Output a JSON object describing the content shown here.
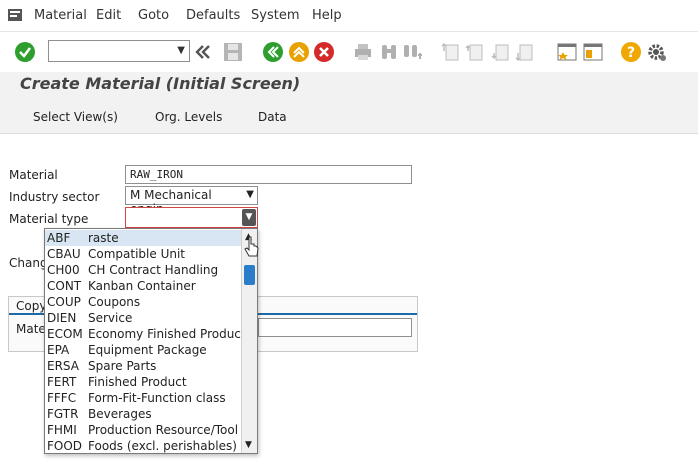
{
  "menu": {
    "items": [
      "Material",
      "Edit",
      "Goto",
      "Defaults",
      "System",
      "Help"
    ]
  },
  "toolbar": {
    "command_field_value": ""
  },
  "title": "Create Material (Initial Screen)",
  "app_toolbar": {
    "buttons": [
      "Select View(s)",
      "Org. Levels",
      "Data"
    ]
  },
  "form": {
    "material_label": "Material",
    "material_value": "RAW_IRON",
    "industry_label": "Industry sector",
    "industry_value": "M Mechanical engin...",
    "type_label": "Material type",
    "type_value": "",
    "change_label_partial": "Chang",
    "copy_tab_partial": "Copy",
    "copy_material_partial": "Mate"
  },
  "dropdown": {
    "options": [
      {
        "code": "ABF",
        "desc": "raste"
      },
      {
        "code": "CBAU",
        "desc": "Compatible Unit"
      },
      {
        "code": "CH00",
        "desc": "CH Contract Handling"
      },
      {
        "code": "CONT",
        "desc": "Kanban Container"
      },
      {
        "code": "COUP",
        "desc": "Coupons"
      },
      {
        "code": "DIEN",
        "desc": "Service"
      },
      {
        "code": "ECOM",
        "desc": "Economy Finished Product"
      },
      {
        "code": "EPA",
        "desc": "Equipment Package"
      },
      {
        "code": "ERSA",
        "desc": "Spare Parts"
      },
      {
        "code": "FERT",
        "desc": "Finished Product"
      },
      {
        "code": "FFFC",
        "desc": "Form-Fit-Function class"
      },
      {
        "code": "FGTR",
        "desc": "Beverages"
      },
      {
        "code": "FHMI",
        "desc": "Production Resource/Tool"
      },
      {
        "code": "FOOD",
        "desc": "Foods (excl. perishables)"
      }
    ]
  },
  "colors": {
    "accent_blue": "#1c6aa8",
    "ok_green": "#2e9e2e",
    "back_green": "#2e9e2e",
    "exit_yellow": "#e8a100",
    "cancel_red": "#d42a2a",
    "help_yellow": "#f0a800"
  },
  "icons": {
    "enter": "check-circle-icon",
    "history": "double-chevron-left-icon",
    "save": "save-icon",
    "back": "back-circle-icon",
    "exit": "exit-circle-icon",
    "cancel": "cancel-circle-icon",
    "help": "help-icon",
    "settings": "gear-icon"
  }
}
